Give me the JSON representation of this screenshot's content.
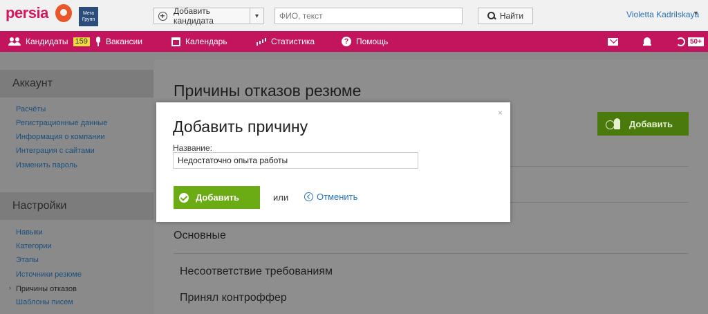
{
  "header": {
    "logo_text": "persia",
    "partner_logo_text": "Мега Групп",
    "add_candidate_label": "Добавить кандидата",
    "search_placeholder": "ФИО, текст",
    "search_value": "",
    "find_label": "Найти",
    "user_name": "Violetta Kadrilskaya"
  },
  "nav": {
    "items": [
      {
        "label": "Кандидаты",
        "badge": "159",
        "icon": "people-icon"
      },
      {
        "label": "Вакансии",
        "icon": "microphone-icon"
      },
      {
        "label": "Календарь",
        "icon": "calendar-icon"
      },
      {
        "label": "Статистика",
        "icon": "bar-chart-icon"
      },
      {
        "label": "Помощь",
        "icon": "help-icon"
      }
    ],
    "right": {
      "mail_icon": "mail-icon",
      "bell_icon": "bell-icon",
      "history_icon": "history-icon",
      "history_badge": "50+"
    }
  },
  "sidebar": {
    "account_title": "Аккаунт",
    "account_links": [
      "Расчёты",
      "Регистрационные данные",
      "Информация о компании",
      "Интеграция с сайтами",
      "Изменить пароль"
    ],
    "settings_title": "Настройки",
    "settings_links": [
      "Навыки",
      "Категории",
      "Этапы",
      "Источники резюме",
      "Причины отказов",
      "Шаблоны писем"
    ],
    "current_link": "Причины отказов"
  },
  "main": {
    "page_title": "Причины отказов резюме",
    "add_button_label": "Добавить",
    "section_label": "Основные",
    "reasons": [
      "Несоответствие требованиям",
      "Принял контроффер"
    ]
  },
  "modal": {
    "title": "Добавить причину",
    "close_symbol": "×",
    "field_label": "Название:",
    "field_value": "Недостаточно опыта работы",
    "submit_label": "Добавить",
    "or_text": "или",
    "cancel_label": "Отменить"
  },
  "colors": {
    "brand": "#c3155e",
    "accent_green": "#6bac14",
    "link_blue": "#2a73b8",
    "badge_yellow": "#f2dc3c"
  }
}
